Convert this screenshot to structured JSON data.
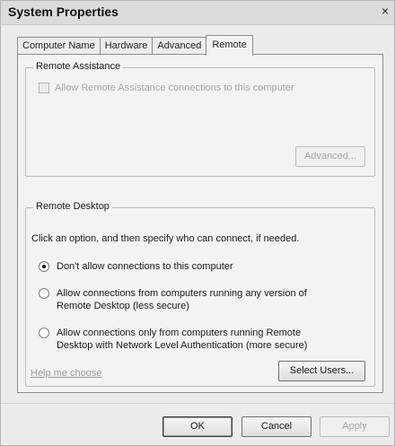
{
  "window": {
    "title": "System Properties",
    "close_glyph": "×"
  },
  "tabs": [
    {
      "label": "Computer Name",
      "active": false
    },
    {
      "label": "Hardware",
      "active": false
    },
    {
      "label": "Advanced",
      "active": false
    },
    {
      "label": "Remote",
      "active": true
    }
  ],
  "remote_assistance": {
    "group_title": "Remote Assistance",
    "allow_label": "Allow Remote Assistance connections to this computer",
    "allow_checked": false,
    "allow_enabled": false,
    "advanced_button": "Advanced...",
    "advanced_enabled": false
  },
  "remote_desktop": {
    "group_title": "Remote Desktop",
    "instructions": "Click an option, and then specify who can connect, if needed.",
    "options": [
      {
        "line1": "Don't allow connections to this computer",
        "line2": "",
        "checked": true
      },
      {
        "line1": "Allow connections from computers running any version of",
        "line2": "Remote Desktop (less secure)",
        "checked": false
      },
      {
        "line1": "Allow connections only from computers running Remote",
        "line2": "Desktop with Network Level Authentication (more secure)",
        "checked": false
      }
    ],
    "help_link": "Help me choose",
    "select_users_button": "Select Users..."
  },
  "footer": {
    "ok": "OK",
    "cancel": "Cancel",
    "apply": "Apply",
    "apply_enabled": false
  },
  "colors": {
    "window_bg": "#ececec",
    "panel_bg": "#f3f3f3",
    "disabled_text": "#a6a6a6",
    "border": "#8e8e8e"
  },
  "icons": {
    "close": "close-icon",
    "checkbox": "checkbox-icon",
    "radio": "radio-icon"
  }
}
